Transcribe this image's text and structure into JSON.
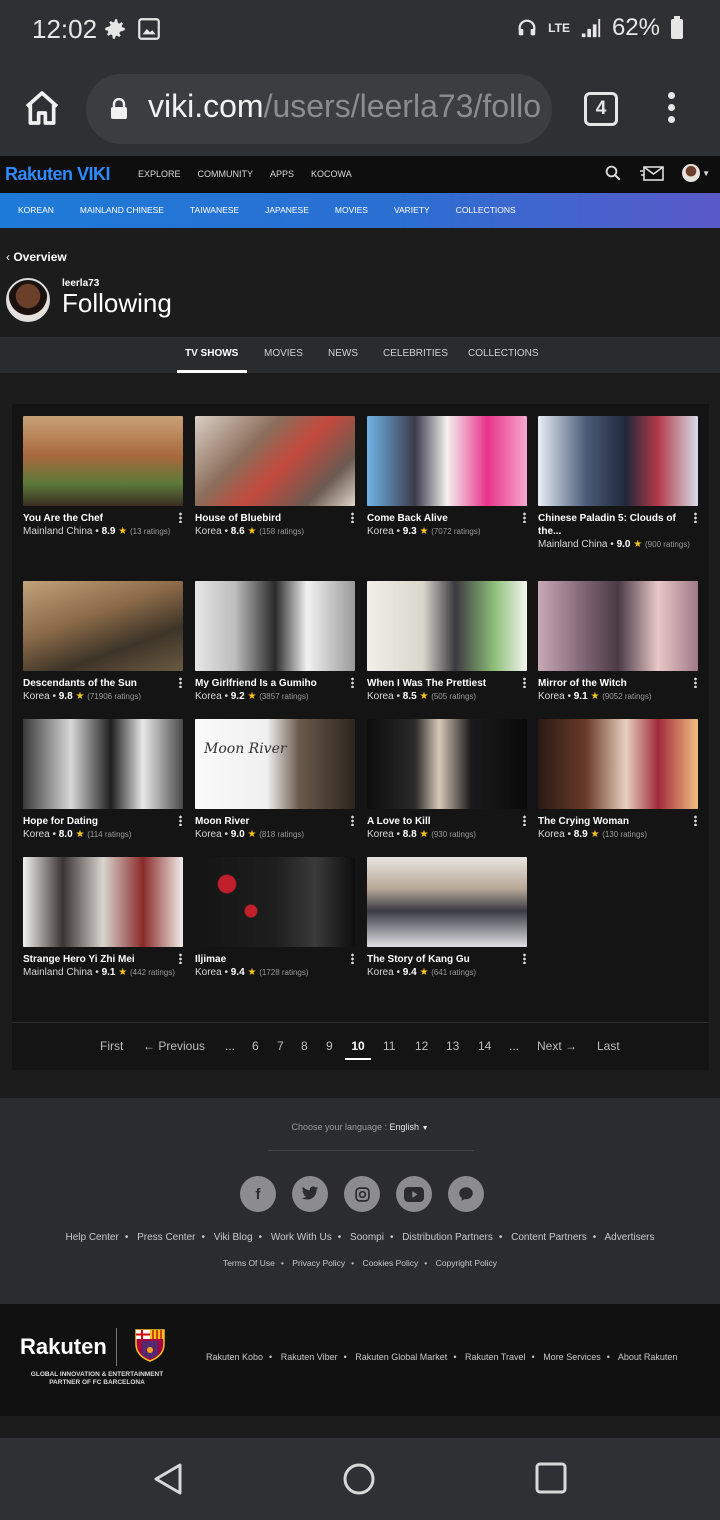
{
  "status_bar": {
    "time": "12:02",
    "network": "LTE",
    "battery": "62%"
  },
  "browser": {
    "url_host": "viki.com",
    "url_path": "/users/leerla73/follo",
    "tab_count": "4"
  },
  "header": {
    "logo": "Rakuten VIKI",
    "nav": [
      "EXPLORE",
      "COMMUNITY",
      "APPS",
      "KOCOWA"
    ]
  },
  "categories": [
    "KOREAN",
    "MAINLAND CHINESE",
    "TAIWANESE",
    "JAPANESE",
    "MOVIES",
    "VARIETY",
    "COLLECTIONS"
  ],
  "profile": {
    "back_label": "Overview",
    "username": "leerla73",
    "heading": "Following"
  },
  "tabs": [
    "TV SHOWS",
    "MOVIES",
    "NEWS",
    "CELEBRITIES",
    "COLLECTIONS"
  ],
  "active_tab": "TV SHOWS",
  "shows": [
    {
      "title": "You Are the Chef",
      "origin": "Mainland China",
      "score": "8.9",
      "ratings": "(13 ratings)"
    },
    {
      "title": "House of Bluebird",
      "origin": "Korea",
      "score": "8.6",
      "ratings": "(158 ratings)"
    },
    {
      "title": "Come Back Alive",
      "origin": "Korea",
      "score": "9.3",
      "ratings": "(7072 ratings)"
    },
    {
      "title": "Chinese Paladin 5: Clouds of the...",
      "origin": "Mainland China",
      "score": "9.0",
      "ratings": "(900 ratings)"
    },
    {
      "title": "Descendants of the Sun",
      "origin": "Korea",
      "score": "9.8",
      "ratings": "(71906 ratings)"
    },
    {
      "title": "My Girlfriend Is a Gumiho",
      "origin": "Korea",
      "score": "9.2",
      "ratings": "(3857 ratings)"
    },
    {
      "title": "When I Was The Prettiest",
      "origin": "Korea",
      "score": "8.5",
      "ratings": "(505 ratings)"
    },
    {
      "title": "Mirror of the Witch",
      "origin": "Korea",
      "score": "9.1",
      "ratings": "(9052 ratings)"
    },
    {
      "title": "Hope for Dating",
      "origin": "Korea",
      "score": "8.0",
      "ratings": "(114 ratings)"
    },
    {
      "title": "Moon River",
      "origin": "Korea",
      "score": "9.0",
      "ratings": "(818 ratings)"
    },
    {
      "title": "A Love to Kill",
      "origin": "Korea",
      "score": "8.8",
      "ratings": "(930 ratings)"
    },
    {
      "title": "The Crying Woman",
      "origin": "Korea",
      "score": "8.9",
      "ratings": "(130 ratings)"
    },
    {
      "title": "Strange Hero Yi Zhi Mei",
      "origin": "Mainland China",
      "score": "9.1",
      "ratings": "(442 ratings)"
    },
    {
      "title": "Iljimae",
      "origin": "Korea",
      "score": "9.4",
      "ratings": "(1728 ratings)"
    },
    {
      "title": "The Story of Kang Gu",
      "origin": "Korea",
      "score": "9.4",
      "ratings": "(641 ratings)"
    }
  ],
  "thumb_overlay_text": "Moon River",
  "pagination": {
    "first": "First",
    "previous": "← Previous",
    "ellipsis": "...",
    "pages": [
      "6",
      "7",
      "8",
      "9",
      "10",
      "11",
      "12",
      "13",
      "14"
    ],
    "current": "10",
    "next": "Next →",
    "last": "Last"
  },
  "footer": {
    "language_prompt": "Choose your language :",
    "language": "English",
    "links": [
      "Help Center",
      "Press Center",
      "Viki Blog",
      "Work With Us",
      "Soompi",
      "Distribution Partners",
      "Content Partners",
      "Advertisers"
    ],
    "legal": [
      "Terms Of Use",
      "Privacy Policy",
      "Cookies Policy",
      "Copyright Policy"
    ],
    "rakuten_logo": "Rakuten",
    "partner_line1": "GLOBAL INNOVATION & ENTERTAINMENT",
    "partner_line2": "PARTNER OF FC BARCELONA",
    "services": [
      "Rakuten Kobo",
      "Rakuten Viber",
      "Rakuten Global Market",
      "Rakuten Travel",
      "More Services",
      "About Rakuten"
    ]
  },
  "colors": {
    "brand_blue": "#2d8bff",
    "star": "#f6c31b"
  }
}
